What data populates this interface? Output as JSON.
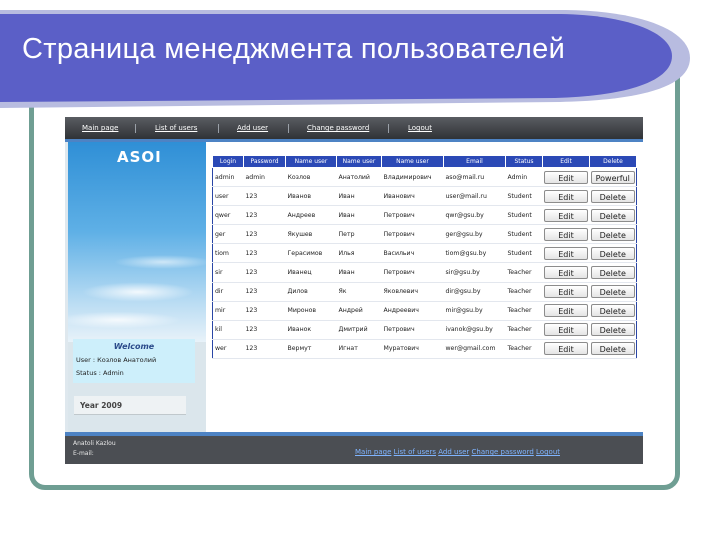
{
  "slide": {
    "title": "Страница менеджмента пользователей"
  },
  "topnav": {
    "items": [
      "Main page",
      "List of users",
      "Add user",
      "Change password",
      "Logout"
    ]
  },
  "sidebar": {
    "logo": "ASOI",
    "welcome_title": "Welcome",
    "user_line": "User : Козлов Анатолий",
    "status_line": "Status : Admin",
    "year": "Year 2009"
  },
  "table": {
    "headers": [
      "Login",
      "Password",
      "Name user",
      "Name user",
      "Name user",
      "Email",
      "Status",
      "Edit",
      "Delete"
    ],
    "rows": [
      {
        "login": "admin",
        "password": "admin",
        "last": "Козлов",
        "first": "Анатолий",
        "middle": "Владимирович",
        "email": "aso@mail.ru",
        "status": "Admin",
        "edit": "Edit",
        "delete": "Powerful"
      },
      {
        "login": "user",
        "password": "123",
        "last": "Иванов",
        "first": "Иван",
        "middle": "Иванович",
        "email": "user@mail.ru",
        "status": "Student",
        "edit": "Edit",
        "delete": "Delete"
      },
      {
        "login": "qwer",
        "password": "123",
        "last": "Андреев",
        "first": "Иван",
        "middle": "Петрович",
        "email": "qwr@gsu.by",
        "status": "Student",
        "edit": "Edit",
        "delete": "Delete"
      },
      {
        "login": "ger",
        "password": "123",
        "last": "Якушев",
        "first": "Петр",
        "middle": "Петрович",
        "email": "ger@gsu.by",
        "status": "Student",
        "edit": "Edit",
        "delete": "Delete"
      },
      {
        "login": "tiom",
        "password": "123",
        "last": "Герасимов",
        "first": "Илья",
        "middle": "Васильич",
        "email": "tiom@gsu.by",
        "status": "Student",
        "edit": "Edit",
        "delete": "Delete"
      },
      {
        "login": "sir",
        "password": "123",
        "last": "Иванец",
        "first": "Иван",
        "middle": "Петрович",
        "email": "sir@gsu.by",
        "status": "Teacher",
        "edit": "Edit",
        "delete": "Delete"
      },
      {
        "login": "dir",
        "password": "123",
        "last": "Дилов",
        "first": "Як",
        "middle": "Яковлевич",
        "email": "dir@gsu.by",
        "status": "Teacher",
        "edit": "Edit",
        "delete": "Delete"
      },
      {
        "login": "mir",
        "password": "123",
        "last": "Миронов",
        "first": "Андрей",
        "middle": "Андреевич",
        "email": "mir@gsu.by",
        "status": "Teacher",
        "edit": "Edit",
        "delete": "Delete"
      },
      {
        "login": "kil",
        "password": "123",
        "last": "Иванок",
        "first": "Дмитрий",
        "middle": "Петрович",
        "email": "ivanok@gsu.by",
        "status": "Teacher",
        "edit": "Edit",
        "delete": "Delete"
      },
      {
        "login": "wer",
        "password": "123",
        "last": "Вермут",
        "first": "Игнат",
        "middle": "Муратович",
        "email": "wer@gmail.com",
        "status": "Teacher",
        "edit": "Edit",
        "delete": "Delete"
      }
    ]
  },
  "footer": {
    "author": "Anatoli Kazlou",
    "email_label": "E-mail:",
    "links": [
      "Main page",
      "List of users",
      "Add user",
      "Change password",
      "Logout"
    ]
  },
  "colors": {
    "banner": "#5b5fc7",
    "frame": "#6f9e93",
    "table_header": "#2b49b6",
    "nav_accent": "#4d83c4"
  }
}
